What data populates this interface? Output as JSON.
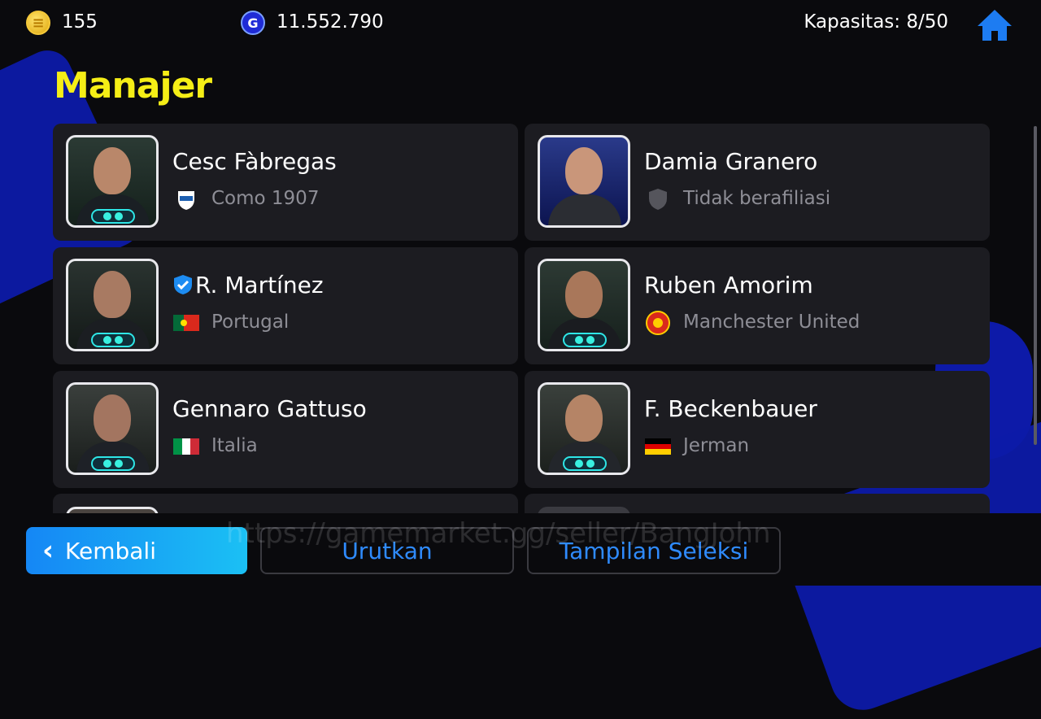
{
  "topbar": {
    "coins_icon": "gold-coin-icon",
    "coins": "155",
    "gp_icon": "gp-coin-icon",
    "gp": "11.552.790",
    "capacity": "Kapasitas: 8/50",
    "home_icon": "home-icon"
  },
  "page": {
    "title": "Manajer"
  },
  "managers": [
    {
      "name": "Cesc Fàbregas",
      "affiliation": "Como 1907",
      "aff_icon": "como-1907-crest-icon"
    },
    {
      "name": "Damia Granero",
      "affiliation": "Tidak berafiliasi",
      "aff_icon": "shield-icon"
    },
    {
      "name": "R. Martínez",
      "affiliation": "Portugal",
      "aff_icon": "portugal-flag-icon",
      "verified": true
    },
    {
      "name": "Ruben Amorim",
      "affiliation": "Manchester United",
      "aff_icon": "manchester-united-crest-icon"
    },
    {
      "name": "Gennaro Gattuso",
      "affiliation": "Italia",
      "aff_icon": "italy-flag-icon"
    },
    {
      "name": "F. Beckenbauer",
      "affiliation": "Jerman",
      "aff_icon": "germany-flag-icon"
    }
  ],
  "buttons": {
    "back": "Kembali",
    "sort": "Urutkan",
    "view": "Tampilan Seleksi"
  },
  "watermark": "https://gamemarket.gg/seller/BangJohn",
  "colors": {
    "title": "#f5ee16",
    "accent_blue": "#1587f5",
    "card": "#1c1c21"
  }
}
